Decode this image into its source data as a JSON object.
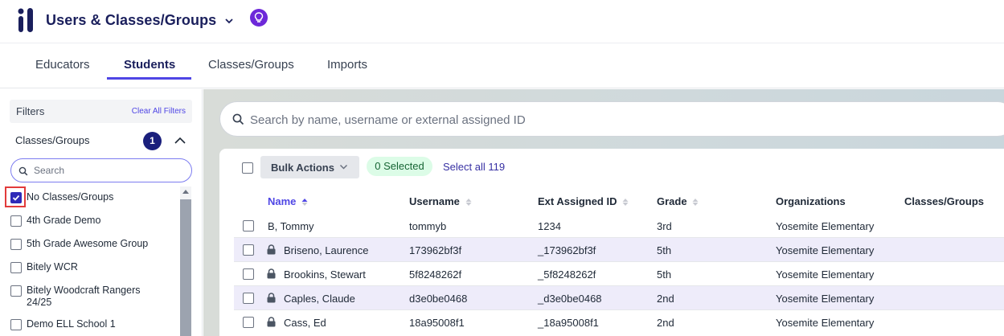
{
  "header": {
    "title": "Users & Classes/Groups",
    "icons": {
      "logo": "app-logo",
      "dropdown": "chevron-down-icon",
      "tips": "lightbulb-icon"
    },
    "accent": "#6d28d9"
  },
  "tabs": [
    {
      "label": "Educators",
      "active": false
    },
    {
      "label": "Students",
      "active": true
    },
    {
      "label": "Classes/Groups",
      "active": false
    },
    {
      "label": "Imports",
      "active": false
    }
  ],
  "sidebar": {
    "filters_label": "Filters",
    "clear_label": "Clear All Filters",
    "section_label": "Classes/Groups",
    "section_count": "1",
    "search_placeholder": "Search",
    "items": [
      {
        "label": "No Classes/Groups",
        "checked": true
      },
      {
        "label": "4th Grade Demo",
        "checked": false
      },
      {
        "label": "5th Grade Awesome Group",
        "checked": false
      },
      {
        "label": "Bitely WCR",
        "checked": false
      },
      {
        "label": "Bitely Woodcraft Rangers 24/25",
        "checked": false
      },
      {
        "label": "Demo ELL School 1",
        "checked": false
      }
    ]
  },
  "main": {
    "search_placeholder": "Search by name, username or external assigned ID",
    "bulk_actions_label": "Bulk Actions",
    "selected_label": "0 Selected",
    "select_all_label": "Select all 119",
    "columns": [
      "Name",
      "Username",
      "Ext Assigned ID",
      "Grade",
      "Organizations",
      "Classes/Groups"
    ],
    "rows": [
      {
        "name": "B, Tommy",
        "username": "tommyb",
        "ext_id": "1234",
        "grade": "3rd",
        "org": "Yosemite Elementary",
        "classes": "",
        "locked": false
      },
      {
        "name": "Briseno, Laurence",
        "username": "173962bf3f",
        "ext_id": "_173962bf3f",
        "grade": "5th",
        "org": "Yosemite Elementary",
        "classes": "",
        "locked": true
      },
      {
        "name": "Brookins, Stewart",
        "username": "5f8248262f",
        "ext_id": "_5f8248262f",
        "grade": "5th",
        "org": "Yosemite Elementary",
        "classes": "",
        "locked": true
      },
      {
        "name": "Caples, Claude",
        "username": "d3e0be0468",
        "ext_id": "_d3e0be0468",
        "grade": "2nd",
        "org": "Yosemite Elementary",
        "classes": "",
        "locked": true
      },
      {
        "name": "Cass, Ed",
        "username": "18a95008f1",
        "ext_id": "_18a95008f1",
        "grade": "2nd",
        "org": "Yosemite Elementary",
        "classes": "",
        "locked": true
      }
    ]
  }
}
